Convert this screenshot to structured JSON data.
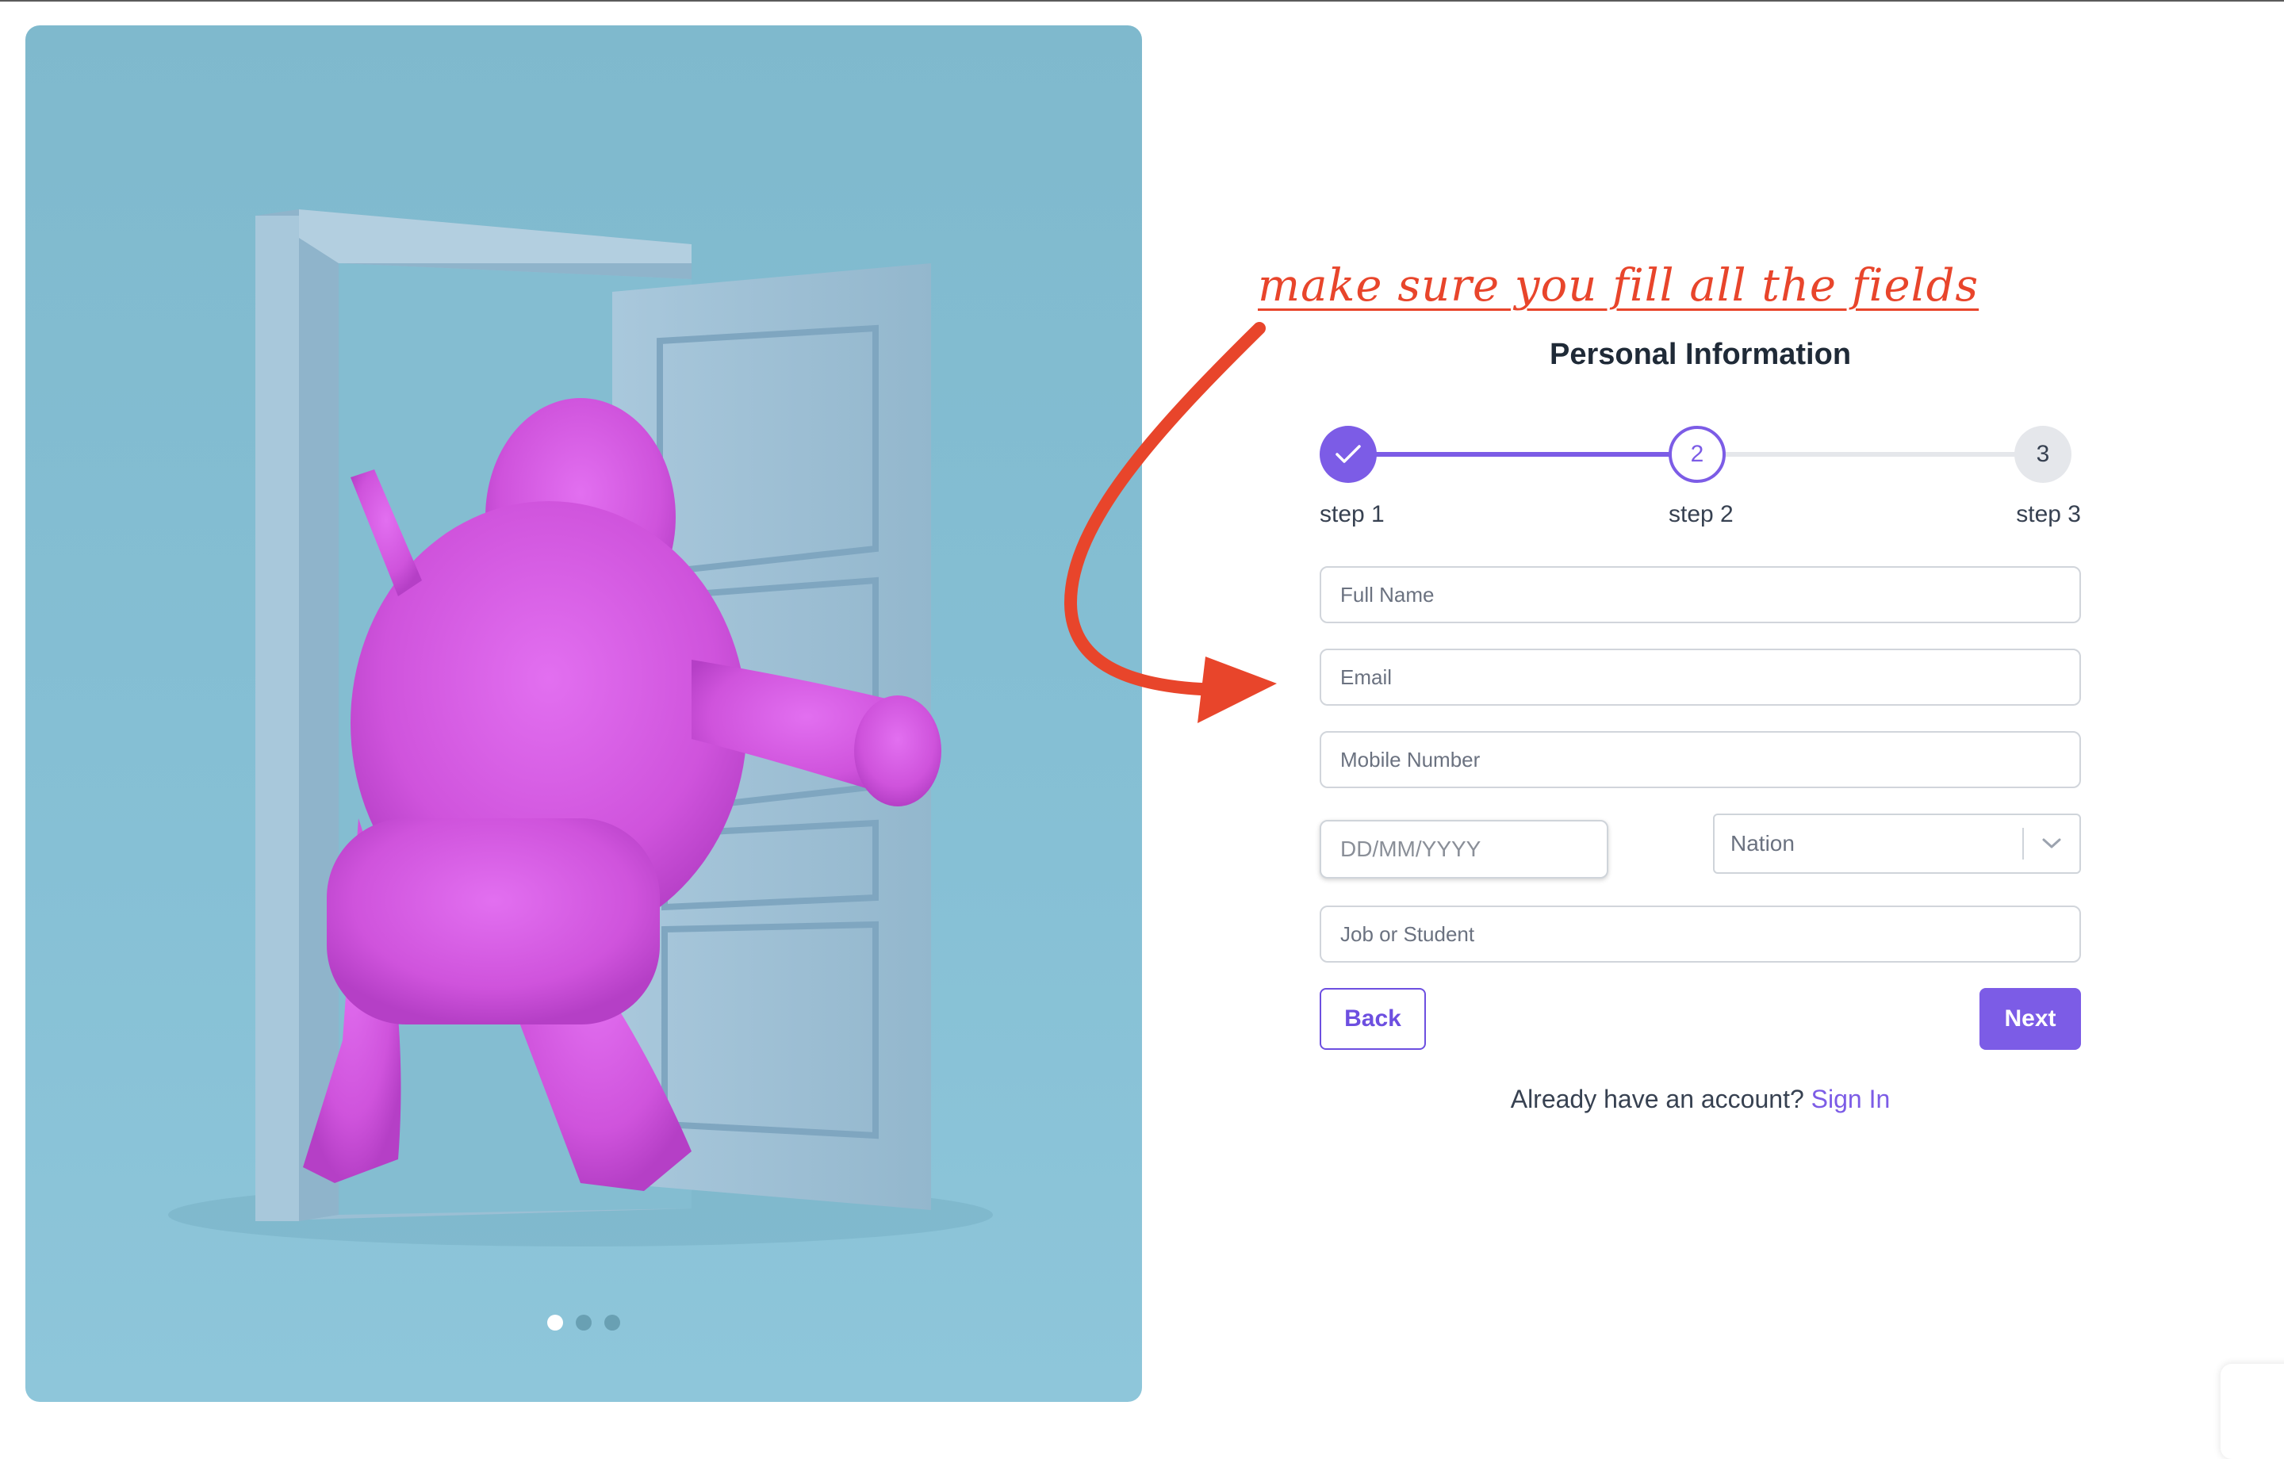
{
  "annotation": {
    "text": "make sure you fill all the fields"
  },
  "form": {
    "title": "Personal Information",
    "steps": [
      {
        "number": "1",
        "label": "step 1",
        "status": "completed"
      },
      {
        "number": "2",
        "label": "step 2",
        "status": "current"
      },
      {
        "number": "3",
        "label": "step 3",
        "status": "pending"
      }
    ],
    "fields": {
      "full_name": {
        "value": "",
        "placeholder": "Full Name"
      },
      "email": {
        "value": "",
        "placeholder": "Email"
      },
      "mobile": {
        "value": "",
        "placeholder": "Mobile Number"
      },
      "dob": {
        "value": "",
        "placeholder": "DD/MM/YYYY"
      },
      "nation": {
        "value": "Nation"
      },
      "job": {
        "value": "",
        "placeholder": "Job or Student"
      }
    },
    "buttons": {
      "back": "Back",
      "next": "Next"
    },
    "signin": {
      "prompt": "Already have an account?",
      "link": "Sign In"
    }
  },
  "carousel": {
    "slides": 3,
    "active_index": 0
  },
  "colors": {
    "accent": "#7c5ce6",
    "annotation": "#e8452b",
    "hero_background": "#86c0d5",
    "creature": "#d75ee0"
  },
  "icons": {
    "step_1": "check-icon",
    "select": "chevron-down-icon"
  }
}
